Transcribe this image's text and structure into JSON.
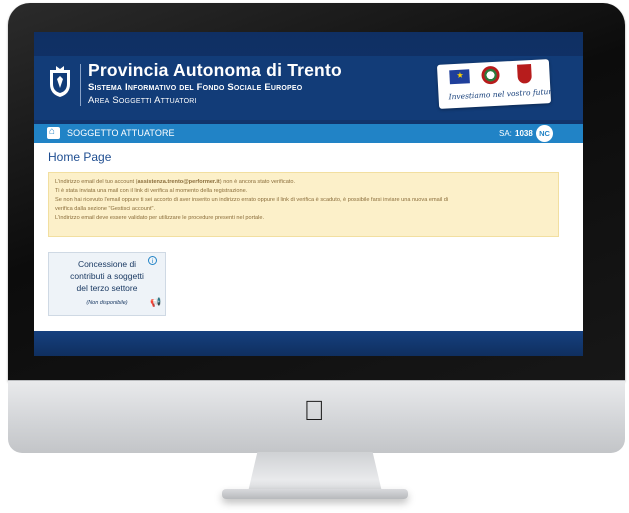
{
  "header": {
    "title": "Provincia Autonoma di Trento",
    "subtitle_1": "Sistema Informativo del Fondo Sociale Europeo",
    "subtitle_2": "Area Soggetti Attuatori",
    "badge_text": "Investiamo nel vostro futuro"
  },
  "navbar": {
    "label": "SOGGETTO ATTUATORE",
    "sa_label": "SA:",
    "sa_value": "1038",
    "user_initials": "NC"
  },
  "page": {
    "title": "Home Page",
    "alert": {
      "line1_pre": "L'indirizzo email del tuo account (",
      "line1_email": "assistenza.trento@performer.it",
      "line1_post": ") non è ancora stato verificato.",
      "line2": "Ti è stata inviata una mail con il link di verifica al momento della registrazione.",
      "line3": "Se non hai ricevuto l'email oppure ti sei accorto di aver inserito un indirizzo errato oppure il link di verifica è scaduto, è possibile farsi inviare una nuova email di",
      "line4": "verifica dalla sezione \"Gestisci account\".",
      "line5": "L'indirizzo email deve essere validato per utilizzare le procedure presenti nel portale."
    },
    "tile": {
      "line1": "Concessione di",
      "line2": "contributi a soggetti",
      "line3": "del terzo settore",
      "status": "(Non disponibile)"
    }
  },
  "colors": {
    "header_bg": "#123c78",
    "navbar_bg": "#2183c6",
    "alert_bg": "#fcf0c9",
    "alert_text": "#8a6d3b",
    "title_text": "#1f4e91"
  },
  "icons": [
    "crest-icon",
    "home-icon",
    "info-icon",
    "megaphone-icon",
    "apple-logo-icon"
  ]
}
